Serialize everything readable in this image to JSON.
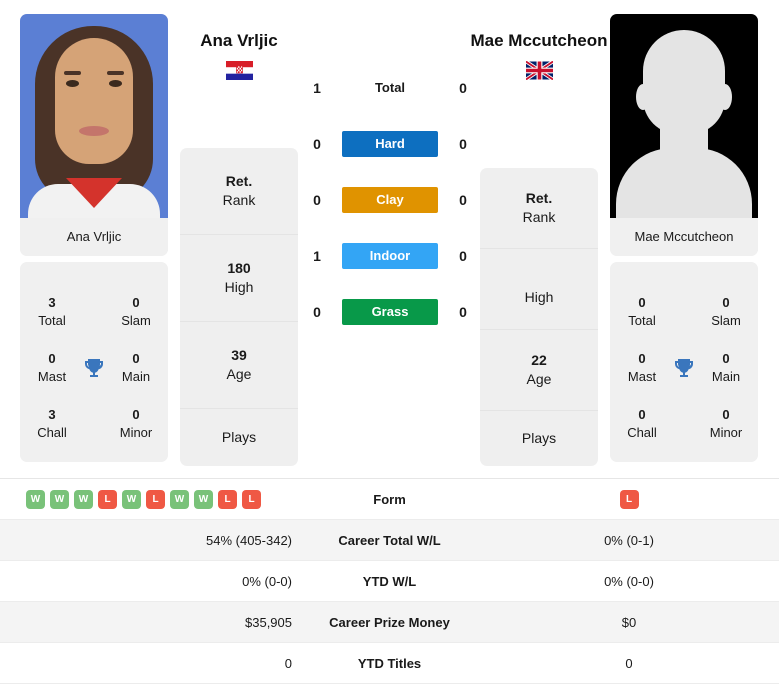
{
  "players": {
    "left": {
      "name": "Ana Vrljic",
      "flag": "croatia-flag",
      "photo_caption": "Ana Vrljic",
      "titles": {
        "total_value": "3",
        "total_label": "Total",
        "slam_value": "0",
        "slam_label": "Slam",
        "mast_value": "0",
        "mast_label": "Mast",
        "main_value": "0",
        "main_label": "Main",
        "chall_value": "3",
        "chall_label": "Chall",
        "minor_value": "0",
        "minor_label": "Minor"
      },
      "info": {
        "rank_value": "Ret.",
        "rank_label": "Rank",
        "high_value": "180",
        "high_label": "High",
        "age_value": "39",
        "age_label": "Age",
        "plays_value": "",
        "plays_label": "Plays"
      },
      "form": [
        "W",
        "W",
        "W",
        "L",
        "W",
        "L",
        "W",
        "W",
        "L",
        "L"
      ],
      "career_total_wl": "54% (405-342)",
      "ytd_wl": "0% (0-0)",
      "career_prize_money": "$35,905",
      "ytd_titles": "0"
    },
    "right": {
      "name": "Mae Mccutcheon",
      "flag": "united-kingdom-flag",
      "photo_caption": "Mae Mccutcheon",
      "titles": {
        "total_value": "0",
        "total_label": "Total",
        "slam_value": "0",
        "slam_label": "Slam",
        "mast_value": "0",
        "mast_label": "Mast",
        "main_value": "0",
        "main_label": "Main",
        "chall_value": "0",
        "chall_label": "Chall",
        "minor_value": "0",
        "minor_label": "Minor"
      },
      "info": {
        "rank_value": "Ret.",
        "rank_label": "Rank",
        "high_value": "",
        "high_label": "High",
        "age_value": "22",
        "age_label": "Age",
        "plays_value": "",
        "plays_label": "Plays"
      },
      "form": [
        "L"
      ],
      "career_total_wl": "0% (0-1)",
      "ytd_wl": "0% (0-0)",
      "career_prize_money": "$0",
      "ytd_titles": "0"
    }
  },
  "surfaces": [
    {
      "label": "Total",
      "left": "1",
      "right": "0",
      "color": ""
    },
    {
      "label": "Hard",
      "left": "0",
      "right": "0",
      "color": "#0d6fc0"
    },
    {
      "label": "Clay",
      "left": "0",
      "right": "0",
      "color": "#e09300"
    },
    {
      "label": "Indoor",
      "left": "1",
      "right": "0",
      "color": "#33a5f5"
    },
    {
      "label": "Grass",
      "left": "0",
      "right": "0",
      "color": "#089949"
    }
  ],
  "stats_rows": [
    {
      "label": "Form",
      "left": "",
      "right": ""
    },
    {
      "label": "Career Total W/L",
      "left": "54% (405-342)",
      "right": "0% (0-1)"
    },
    {
      "label": "YTD W/L",
      "left": "0% (0-0)",
      "right": "0% (0-0)"
    },
    {
      "label": "Career Prize Money",
      "left": "$35,905",
      "right": "$0"
    },
    {
      "label": "YTD Titles",
      "left": "0",
      "right": "0"
    }
  ],
  "colors": {
    "win": "#79c279",
    "loss": "#ef5844",
    "trophy": "#3a76bd",
    "card_bg": "#f0f0f0"
  }
}
